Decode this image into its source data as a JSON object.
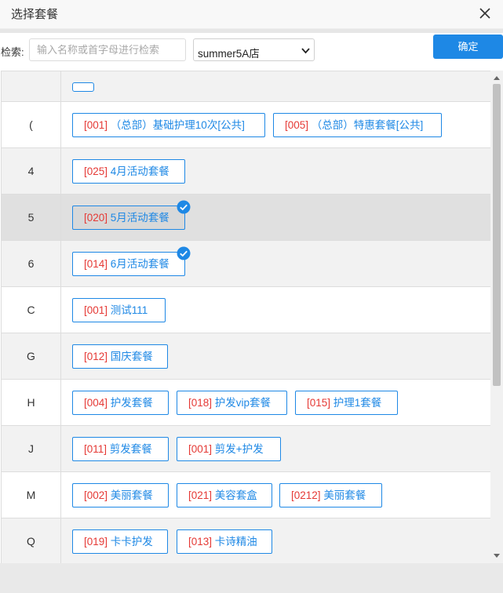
{
  "dialog": {
    "title": "选择套餐"
  },
  "toolbar": {
    "search_label": "检索:",
    "search_placeholder": "输入名称或首字母进行检索",
    "search_value": "",
    "store_selected": "summer5A店",
    "confirm_label": "确定"
  },
  "groups": [
    {
      "letter": "(",
      "items": [
        {
          "code": "[001]",
          "name": "（总部）基础护理10次[公共]"
        },
        {
          "code": "[005]",
          "name": "（总部）特惠套餐[公共]"
        }
      ]
    },
    {
      "letter": "4",
      "items": [
        {
          "code": "[025]",
          "name": "4月活动套餐"
        }
      ]
    },
    {
      "letter": "5",
      "items": [
        {
          "code": "[020]",
          "name": "5月活动套餐",
          "checked": true
        }
      ]
    },
    {
      "letter": "6",
      "items": [
        {
          "code": "[014]",
          "name": "6月活动套餐",
          "checked": true
        }
      ]
    },
    {
      "letter": "C",
      "items": [
        {
          "code": "[001]",
          "name": "测试111"
        }
      ]
    },
    {
      "letter": "G",
      "items": [
        {
          "code": "[012]",
          "name": "国庆套餐"
        }
      ]
    },
    {
      "letter": "H",
      "items": [
        {
          "code": "[004]",
          "name": "护发套餐"
        },
        {
          "code": "[018]",
          "name": "护发vip套餐"
        },
        {
          "code": "[015]",
          "name": "护理1套餐"
        }
      ]
    },
    {
      "letter": "J",
      "items": [
        {
          "code": "[011]",
          "name": "剪发套餐"
        },
        {
          "code": "[001]",
          "name": "剪发+护发"
        }
      ]
    },
    {
      "letter": "M",
      "items": [
        {
          "code": "[002]",
          "name": "美丽套餐"
        },
        {
          "code": "[021]",
          "name": "美容套盒"
        },
        {
          "code": "[0212]",
          "name": "美丽套餐"
        }
      ]
    },
    {
      "letter": "Q",
      "items": [
        {
          "code": "[019]",
          "name": "卡卡护发"
        },
        {
          "code": "[013]",
          "name": "卡诗精油"
        }
      ]
    }
  ],
  "colors": {
    "accent": "#1e88e5",
    "code": "#e53935"
  }
}
